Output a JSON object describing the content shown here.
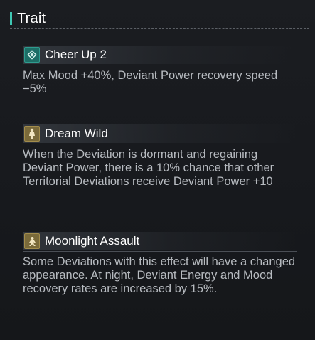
{
  "section": {
    "title": "Trait"
  },
  "traits": [
    {
      "name": "Cheer Up 2",
      "icon": "diamond-icon",
      "description": "Max Mood +40%, Deviant Power recovery speed −5%"
    },
    {
      "name": "Dream Wild",
      "icon": "figure-icon",
      "description": "When the Deviation is dormant and regaining Deviant Power, there is a 10% chance that other Territorial Deviations receive Deviant Power +10"
    },
    {
      "name": "Moonlight Assault",
      "icon": "assault-figure-icon",
      "description": "Some Deviations with this effect will have a changed appearance. At night, Deviant Energy and Mood recovery rates are increased by 15%."
    }
  ],
  "colors": {
    "accent": "#3fc7b3",
    "teal_icon": "#1d6e66",
    "gold_icon": "#7a6a3a"
  }
}
